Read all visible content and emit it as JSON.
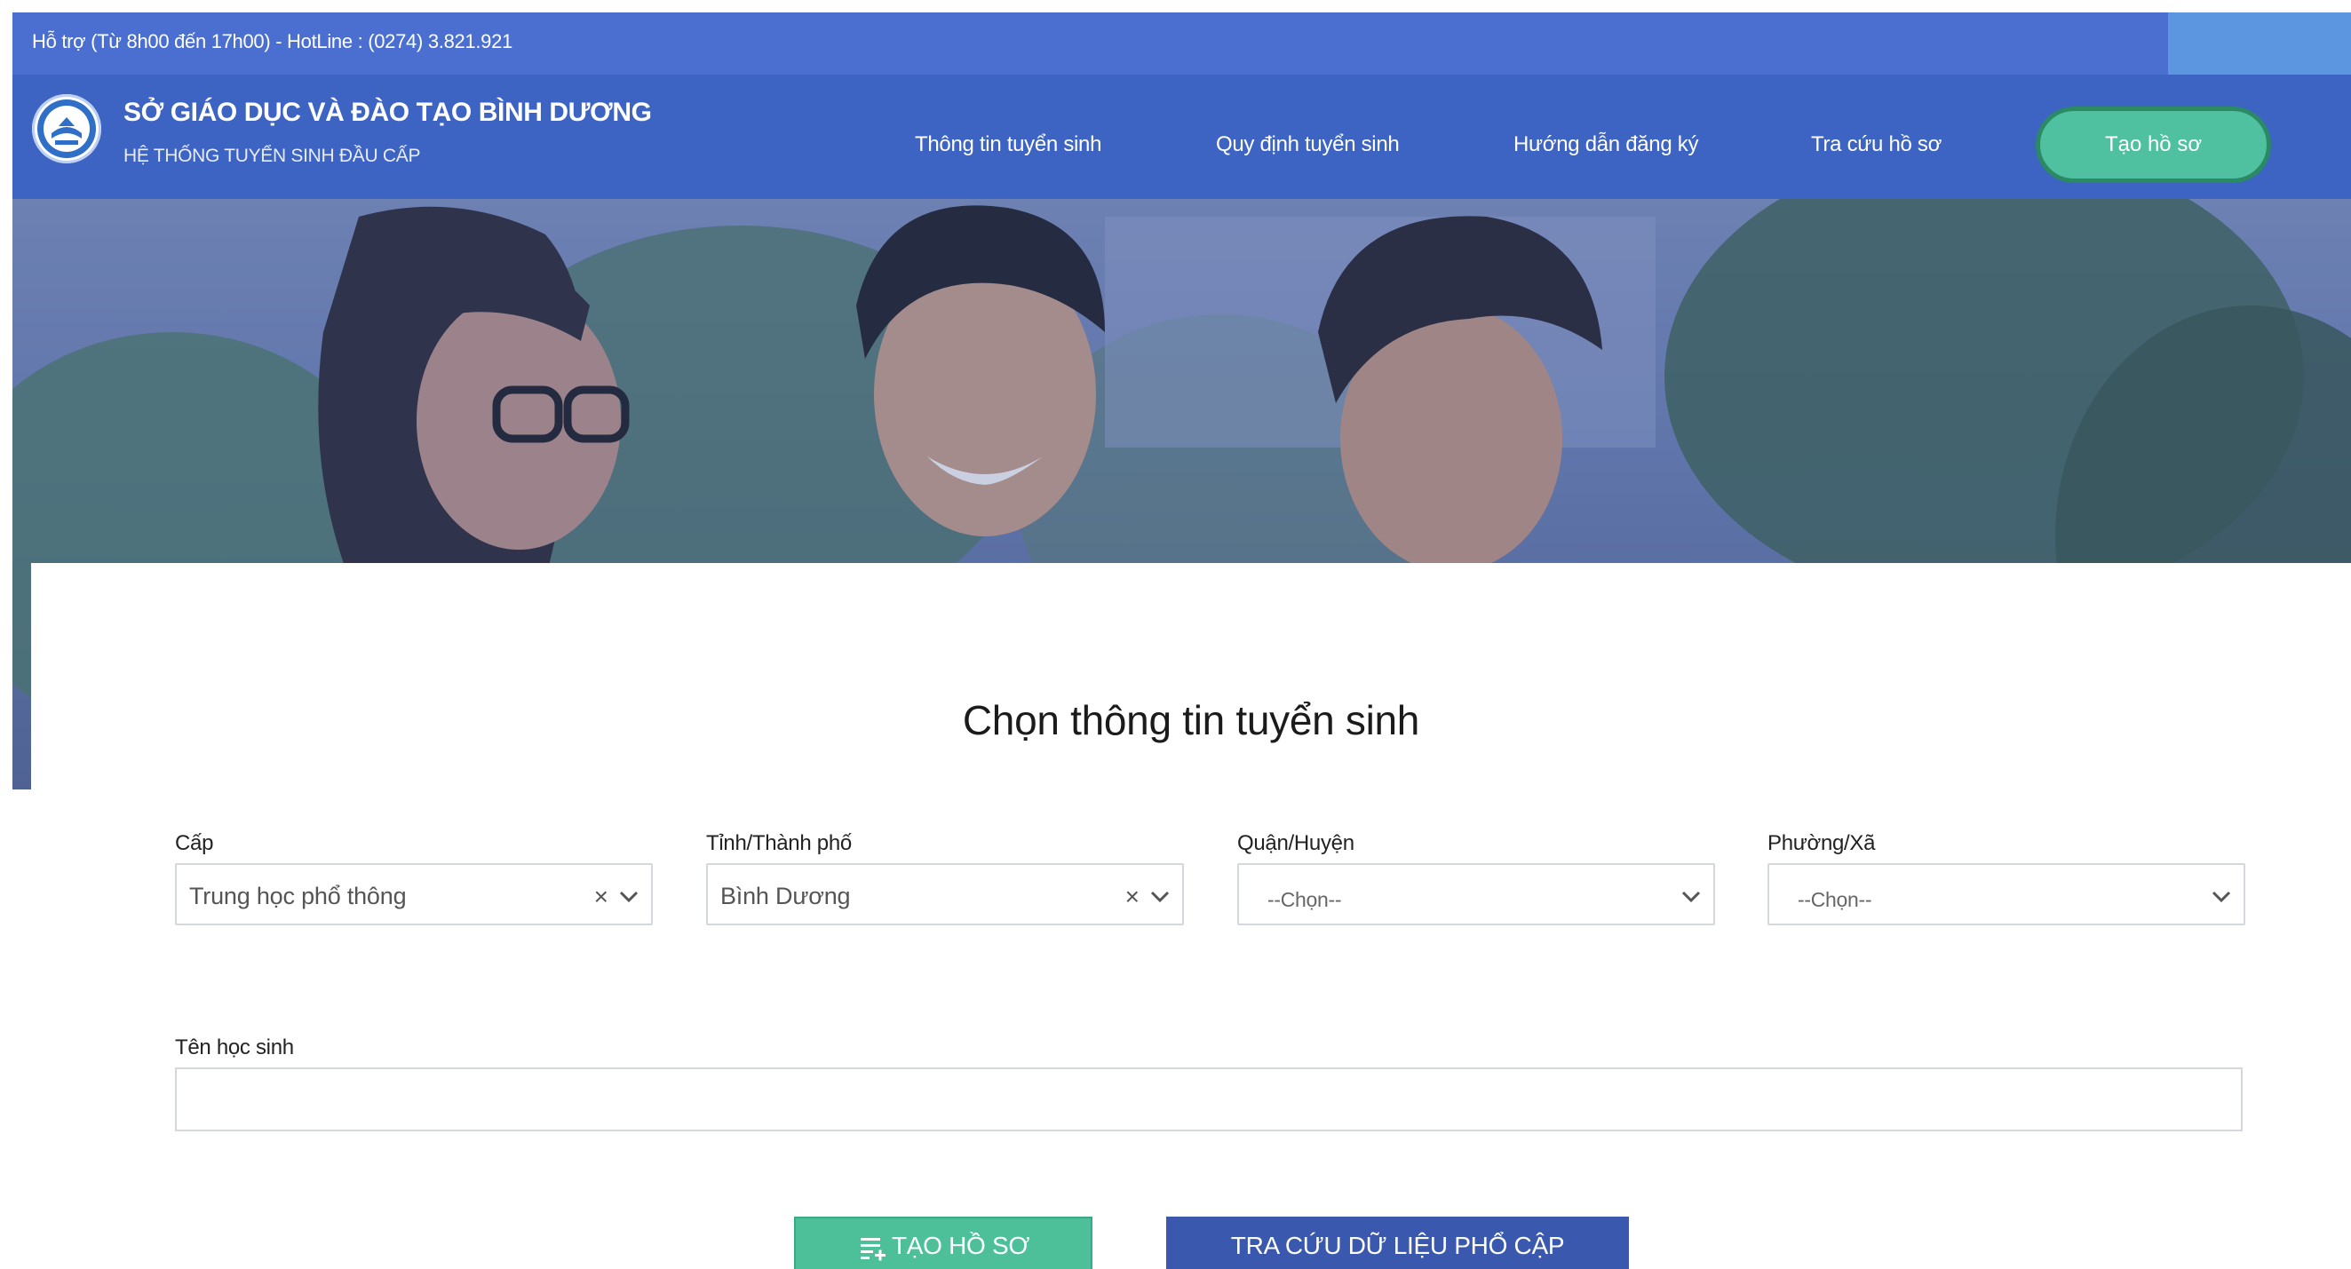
{
  "support": {
    "text": "Hỗ trợ (Từ 8h00 đến 17h00) - HotLine : (0274) 3.821.921"
  },
  "header": {
    "org_name": "SỞ GIÁO DỤC VÀ ĐÀO TẠO BÌNH DƯƠNG",
    "org_sub": "HỆ THỐNG TUYỂN SINH ĐẦU CẤP",
    "nav": [
      "Thông tin tuyển sinh",
      "Quy định tuyển sinh",
      "Hướng dẫn đăng ký",
      "Tra cứu hồ sơ"
    ],
    "cta": "Tạo hồ sơ"
  },
  "form": {
    "title": "Chọn thông tin tuyển sinh",
    "cap": {
      "label": "Cấp",
      "value": "Trung học phổ thông"
    },
    "tinh": {
      "label": "Tỉnh/Thành phố",
      "value": "Bình Dương"
    },
    "quan": {
      "label": "Quận/Huyện",
      "placeholder": "--Chọn--"
    },
    "phuong": {
      "label": "Phường/Xã",
      "placeholder": "--Chọn--"
    },
    "ten": {
      "label": "Tên học sinh",
      "value": ""
    },
    "create_button": "TẠO HỒ SƠ",
    "lookup_button": "TRA CỨU DỮ LIỆU PHỔ CẬP"
  },
  "colors": {
    "support_bar": "#4a6fd0",
    "header": "#3d63c3",
    "cta": "#4fc0a0",
    "create_button": "#4dc09a",
    "lookup_button": "#3a58ad"
  }
}
